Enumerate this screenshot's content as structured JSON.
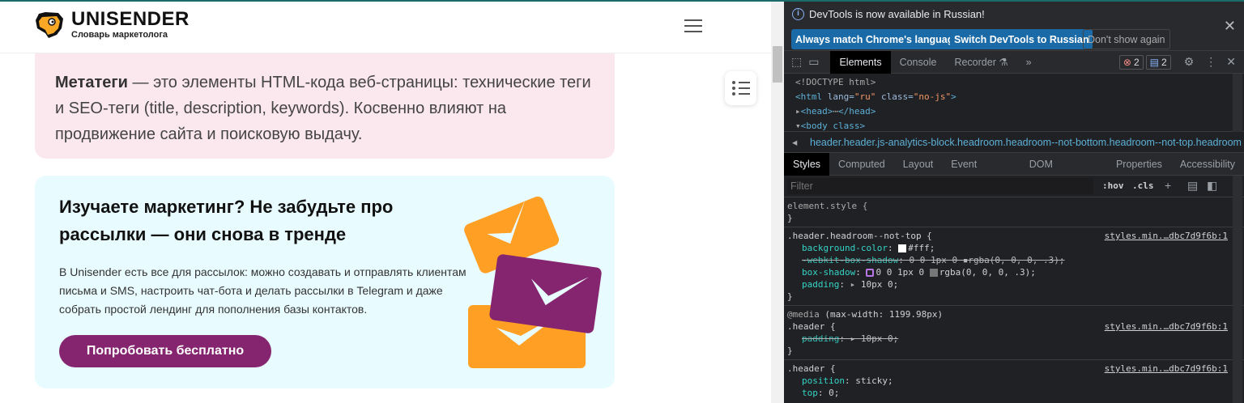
{
  "page": {
    "logo": {
      "brand": "UNISENDER",
      "subtitle": "Словарь маркетолога"
    },
    "definition": {
      "term": "Метатеги",
      "text": " — это элементы HTML-кода веб-страницы: технические теги и SEO-теги (title, description, keywords). Косвенно влияют на продвижение сайта и поисковую выдачу."
    },
    "promo": {
      "title": "Изучаете маркетинг? Не забудьте про рассылки — они снова в тренде",
      "body": "В Unisender есть все для рассылок: можно создавать и отправлять клиентам письма и SMS, настроить чат-бота и делать рассылки в Telegram и даже собрать простой лендинг для пополнения базы контактов.",
      "cta": "Попробовать бесплатно"
    },
    "colors": {
      "pink": "#fbe7ee",
      "blue": "#e8fbff",
      "purple": "#86256f",
      "orange": "#ff9f24"
    }
  },
  "devtools": {
    "notice": "DevTools is now available in Russian!",
    "btn_match": "Always match Chrome's language",
    "btn_switch": "Switch DevTools to Russian",
    "btn_dont": "Don't show again",
    "tabs": [
      "Elements",
      "Console",
      "Recorder",
      "»"
    ],
    "errors": "2",
    "messages": "2",
    "dom": {
      "doctype": "<!DOCTYPE html>",
      "html_open": "<html",
      "lang_attr": "lang=",
      "lang_val": "\"ru\"",
      "class_attr": "class=",
      "class_val": "\"no-js\"",
      "head": "<head>",
      "head_close": "</head>",
      "body": "<body class>"
    },
    "breadcrumb": "header.header.js-analytics-block.headroom.headroom--not-bottom.headroom--not-top.headroom",
    "subtabs": [
      "Styles",
      "Computed",
      "Layout",
      "Event Listeners",
      "DOM Breakpoints",
      "Properties",
      "Accessibility"
    ],
    "filter_placeholder": "Filter",
    "hov": ":hov",
    "cls": ".cls",
    "source": "styles.min.…dbc7d9f6b:1",
    "rules": {
      "r0": "element.style {",
      "r1": ".header.headroom--not-top {",
      "r1p1n": "background-color",
      "r1p1v": "#fff;",
      "r1p2n": "-webkit-box-shadow",
      "r1p2v": "0 0 1px 0 ▪rgba(0, 0, 0, .3);",
      "r1p3n": "box-shadow",
      "r1p3v": "0 0 1px 0",
      "r1p3v2": "rgba(0, 0, 0, .3);",
      "r1p4n": "padding",
      "r1p4v": "10px 0;",
      "media": "@media",
      "media_q": "(max-width: 1199.98px)",
      "r2": ".header {",
      "r2p1n": "padding",
      "r2p1v": "10px 0;",
      "r3": ".header {",
      "r3p1n": "position",
      "r3p1v": "sticky;",
      "r3p2n": "top",
      "r3p2v": "0;"
    }
  }
}
